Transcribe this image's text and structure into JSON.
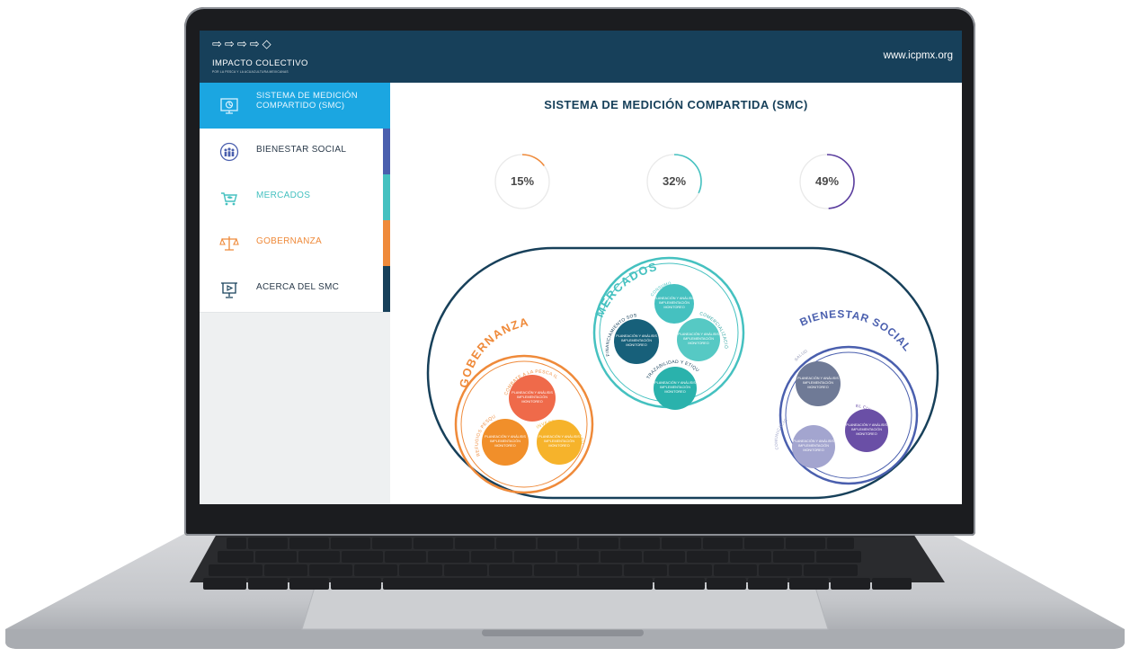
{
  "header": {
    "logo_name": "IMPACTO COLECTIVO",
    "logo_tagline": "POR LA PESCA Y LA ACUACULTURA MEXICANAS",
    "url": "www.icpmx.org"
  },
  "sidebar": {
    "items": [
      {
        "label": "SISTEMA DE MEDICIÓN COMPARTIDO (SMC)",
        "icon": "monitor-chart-icon",
        "color": "#1ba6e1"
      },
      {
        "label": "BIENESTAR SOCIAL",
        "icon": "community-icon",
        "color": "#4a5fae"
      },
      {
        "label": "MERCADOS",
        "icon": "cart-fish-icon",
        "color": "#45c1c0"
      },
      {
        "label": "GOBERNANZA",
        "icon": "scales-icon",
        "color": "#ef8a3a"
      },
      {
        "label": "ACERCA DEL SMC",
        "icon": "presentation-icon",
        "color": "#17405a"
      }
    ]
  },
  "main": {
    "title": "SISTEMA DE MEDICIÓN COMPARTIDA (SMC)",
    "gauges": [
      {
        "value": "15%",
        "fraction": 0.15,
        "color": "#ef8a3a"
      },
      {
        "value": "32%",
        "fraction": 0.32,
        "color": "#45c1c0"
      },
      {
        "value": "49%",
        "fraction": 0.49,
        "color": "#5a3d9e"
      }
    ]
  },
  "diagram": {
    "gobernanza": {
      "title": "GOBERNANZA",
      "arc_labels": [
        "COMBATE A LA PESCA ILEGAL",
        "REFUGIOS PESQUEROS",
        "INVESTIGACIÓN PESQUERA"
      ],
      "bubble_text": [
        "PLANEACIÓN Y ANÁLISIS",
        "IMPLEMENTACIÓN",
        "MONITOREO"
      ]
    },
    "mercados": {
      "title": "MERCADOS",
      "arc_labels": [
        "CONSUMO",
        "FINANCIAMIENTO SOSTENIBLE",
        "COMERCIALIZACIÓN RESPONSABLE",
        "TRAZABILIDAD Y ETIQUETADO"
      ],
      "bubble_text": [
        "PLANEACIÓN Y ANÁLISIS",
        "IMPLEMENTACIÓN",
        "MONITOREO"
      ]
    },
    "bienestar": {
      "title": "BIENESTAR SOCIAL",
      "arc_labels": [
        "SALUD",
        "EL CUIDO",
        "COMUNICACIÓN"
      ],
      "bubble_text": [
        "PLANEACIÓN Y ANÁLISIS",
        "IMPLEMENTACIÓN",
        "MONITOREO"
      ]
    }
  }
}
